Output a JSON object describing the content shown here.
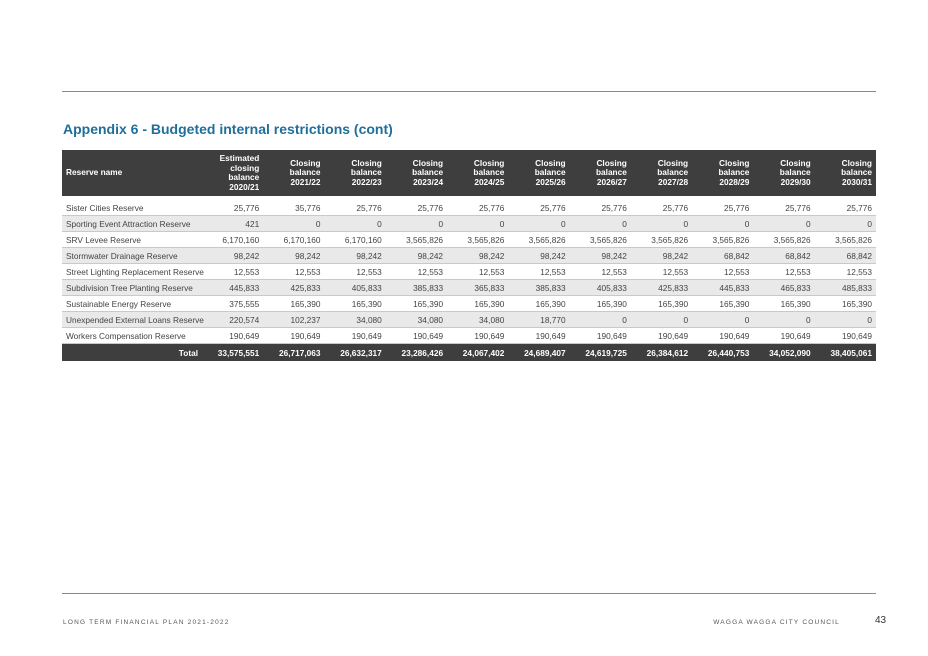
{
  "title": "Appendix 6 - Budgeted internal restrictions (cont)",
  "table": {
    "headers": [
      "Reserve name",
      "Estimated closing balance 2020/21",
      "Closing balance 2021/22",
      "Closing balance 2022/23",
      "Closing balance 2023/24",
      "Closing balance 2024/25",
      "Closing balance 2025/26",
      "Closing balance 2026/27",
      "Closing balance 2027/28",
      "Closing balance 2028/29",
      "Closing balance 2029/30",
      "Closing balance 2030/31"
    ],
    "rows": [
      [
        "Sister Cities Reserve",
        "25,776",
        "35,776",
        "25,776",
        "25,776",
        "25,776",
        "25,776",
        "25,776",
        "25,776",
        "25,776",
        "25,776",
        "25,776"
      ],
      [
        "Sporting Event Attraction Reserve",
        "421",
        "0",
        "0",
        "0",
        "0",
        "0",
        "0",
        "0",
        "0",
        "0",
        "0"
      ],
      [
        "SRV Levee Reserve",
        "6,170,160",
        "6,170,160",
        "6,170,160",
        "3,565,826",
        "3,565,826",
        "3,565,826",
        "3,565,826",
        "3,565,826",
        "3,565,826",
        "3,565,826",
        "3,565,826"
      ],
      [
        "Stormwater Drainage Reserve",
        "98,242",
        "98,242",
        "98,242",
        "98,242",
        "98,242",
        "98,242",
        "98,242",
        "98,242",
        "68,842",
        "68,842",
        "68,842"
      ],
      [
        "Street Lighting Replacement Reserve",
        "12,553",
        "12,553",
        "12,553",
        "12,553",
        "12,553",
        "12,553",
        "12,553",
        "12,553",
        "12,553",
        "12,553",
        "12,553"
      ],
      [
        "Subdivision Tree Planting Reserve",
        "445,833",
        "425,833",
        "405,833",
        "385,833",
        "365,833",
        "385,833",
        "405,833",
        "425,833",
        "445,833",
        "465,833",
        "485,833"
      ],
      [
        "Sustainable Energy Reserve",
        "375,555",
        "165,390",
        "165,390",
        "165,390",
        "165,390",
        "165,390",
        "165,390",
        "165,390",
        "165,390",
        "165,390",
        "165,390"
      ],
      [
        "Unexpended External Loans Reserve",
        "220,574",
        "102,237",
        "34,080",
        "34,080",
        "34,080",
        "18,770",
        "0",
        "0",
        "0",
        "0",
        "0"
      ],
      [
        "Workers Compensation Reserve",
        "190,649",
        "190,649",
        "190,649",
        "190,649",
        "190,649",
        "190,649",
        "190,649",
        "190,649",
        "190,649",
        "190,649",
        "190,649"
      ]
    ],
    "total": [
      "Total",
      "33,575,551",
      "26,717,063",
      "26,632,317",
      "23,286,426",
      "24,067,402",
      "24,689,407",
      "24,619,725",
      "26,384,612",
      "26,440,753",
      "34,052,090",
      "38,405,061"
    ]
  },
  "footer": {
    "left": "LONG TERM FINANCIAL PLAN 2021-2022",
    "right": "WAGGA WAGGA CITY COUNCIL",
    "page_number": "43"
  },
  "colors": {
    "title": "#1f6f9a",
    "header_bg": "#3e3e3e",
    "stripe": "#e9e9e9"
  }
}
